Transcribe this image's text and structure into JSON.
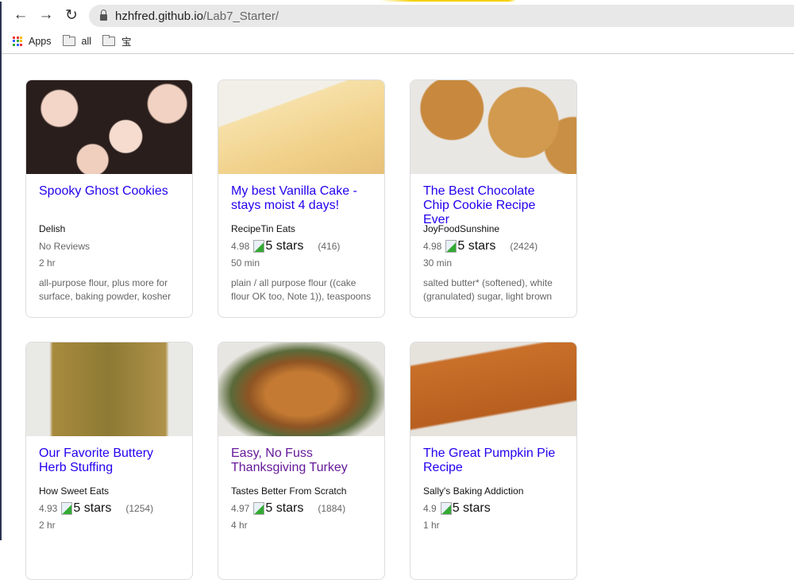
{
  "browser": {
    "url_host": "hzhfred.github.io",
    "url_path": "/Lab7_Starter/",
    "bookmarks": [
      {
        "label": "Apps",
        "icon": "apps-grid-icon"
      },
      {
        "label": "all",
        "icon": "folder-icon"
      },
      {
        "label": "宝",
        "icon": "folder-icon"
      }
    ]
  },
  "colors": {
    "link": "#2200ee",
    "visited": "#661a99",
    "meta": "#666666"
  },
  "recipes": [
    {
      "title": "Spooky Ghost Cookies",
      "publisher": "Delish",
      "rating": "",
      "rating_img_alt": "",
      "reviews": "",
      "no_reviews": "No Reviews",
      "time": "2 hr",
      "ingredients": "all-purpose flour, plus more for surface, baking powder, kosher",
      "visited": false
    },
    {
      "title": "My best Vanilla Cake - stays moist 4 days!",
      "publisher": "RecipeTin Eats",
      "rating": "4.98",
      "rating_img_alt": "5 stars",
      "reviews": "(416)",
      "time": "50 min",
      "ingredients": "plain / all purpose flour ((cake flour OK too, Note 1)), teaspoons",
      "visited": false
    },
    {
      "title": "The Best Chocolate Chip Cookie Recipe Ever",
      "publisher": "JoyFoodSunshine",
      "rating": "4.98",
      "rating_img_alt": "5 stars",
      "reviews": "(2424)",
      "time": "30 min",
      "ingredients": "salted butter* (softened), white (granulated) sugar, light brown",
      "visited": false
    },
    {
      "title": "Our Favorite Buttery Herb Stuffing",
      "publisher": "How Sweet Eats",
      "rating": "4.93",
      "rating_img_alt": "5 stars",
      "reviews": "(1254)",
      "time": "2 hr",
      "ingredients": "",
      "visited": false
    },
    {
      "title": "Easy, No Fuss Thanksgiving Turkey",
      "publisher": "Tastes Better From Scratch",
      "rating": "4.97",
      "rating_img_alt": "5 stars",
      "reviews": "(1884)",
      "time": "4 hr",
      "ingredients": "",
      "visited": true
    },
    {
      "title": "The Great Pumpkin Pie Recipe",
      "publisher": "Sally's Baking Addiction",
      "rating": "4.9",
      "rating_img_alt": "5 stars",
      "reviews": "",
      "time": "1 hr",
      "ingredients": "",
      "visited": false
    }
  ]
}
